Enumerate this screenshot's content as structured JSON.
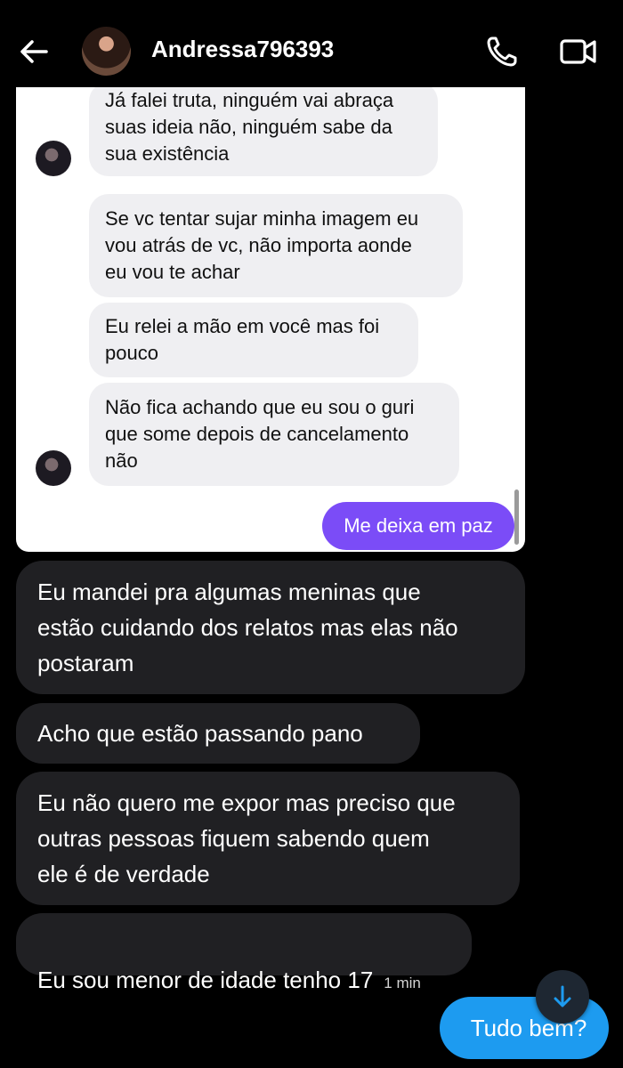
{
  "header": {
    "username": "Andressa796393",
    "icons": {
      "back": "back-arrow-icon",
      "call": "phone-icon",
      "video": "video-camera-icon"
    }
  },
  "embedded": {
    "messages": [
      {
        "text": "Já falei truta, ninguém vai abraça\nsuas ideia não, ninguém sabe da\nsua existência"
      },
      {
        "text": "Se vc tentar sujar minha imagem eu\nvou atrás de vc, não importa aonde\neu vou te achar"
      },
      {
        "text": "Eu relei a mão em você mas foi\npouco"
      },
      {
        "text": "Não fica achando que eu sou o guri\nque some depois de cancelamento\nnão"
      }
    ],
    "sent": "Me deixa em paz",
    "colors": {
      "sent_bubble": "#7b4cf7",
      "received_bubble": "#efeff2"
    }
  },
  "messages": [
    {
      "text": "Eu mandei pra algumas meninas que\nestão cuidando dos relatos mas elas não\npostaram"
    },
    {
      "text": "Acho que estão passando pano"
    },
    {
      "text": "Eu não quero me expor mas preciso que\noutras pessoas fiquem sabendo quem\nele é de verdade"
    },
    {
      "text": "Eu sou menor de idade tenho 17",
      "time": "1 min"
    }
  ],
  "reply": {
    "text": "Tudo bem?"
  },
  "colors": {
    "background": "#000000",
    "received_bubble": "#202023",
    "sent_bubble": "#1d9bf0"
  }
}
